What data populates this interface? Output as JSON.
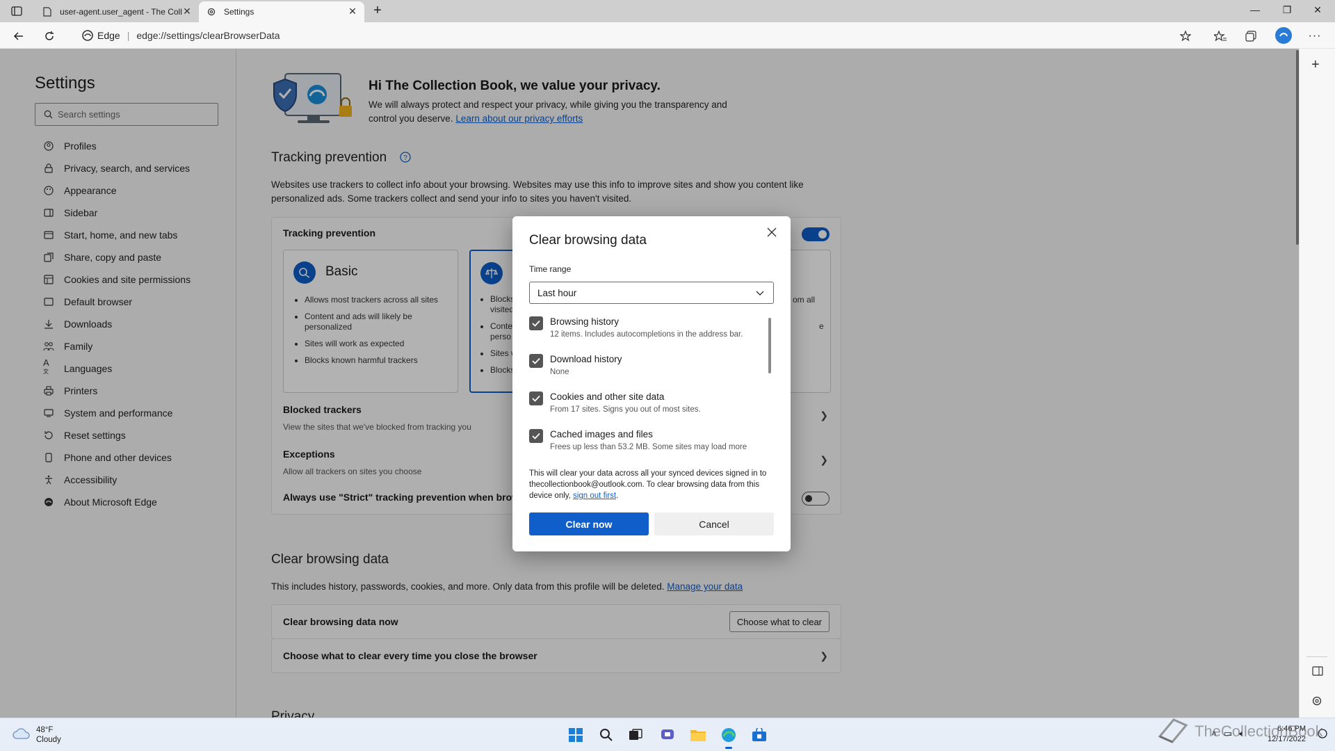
{
  "browser": {
    "tabs": [
      {
        "title": "user-agent.user_agent - The Coll",
        "active": false
      },
      {
        "title": "Settings",
        "active": true
      }
    ],
    "address": {
      "site_label": "Edge",
      "url": "edge://settings/clearBrowserData"
    }
  },
  "sidebar": {
    "title": "Settings",
    "search_placeholder": "Search settings",
    "items": [
      {
        "label": "Profiles",
        "icon": "profile-icon"
      },
      {
        "label": "Privacy, search, and services",
        "icon": "lock-icon"
      },
      {
        "label": "Appearance",
        "icon": "palette-icon"
      },
      {
        "label": "Sidebar",
        "icon": "sidebar-icon"
      },
      {
        "label": "Start, home, and new tabs",
        "icon": "home-icon"
      },
      {
        "label": "Share, copy and paste",
        "icon": "share-icon"
      },
      {
        "label": "Cookies and site permissions",
        "icon": "cookie-icon"
      },
      {
        "label": "Default browser",
        "icon": "browser-icon"
      },
      {
        "label": "Downloads",
        "icon": "download-icon"
      },
      {
        "label": "Family",
        "icon": "family-icon"
      },
      {
        "label": "Languages",
        "icon": "language-icon"
      },
      {
        "label": "Printers",
        "icon": "printer-icon"
      },
      {
        "label": "System and performance",
        "icon": "system-icon"
      },
      {
        "label": "Reset settings",
        "icon": "reset-icon"
      },
      {
        "label": "Phone and other devices",
        "icon": "phone-icon"
      },
      {
        "label": "Accessibility",
        "icon": "accessibility-icon"
      },
      {
        "label": "About Microsoft Edge",
        "icon": "edge-icon"
      }
    ]
  },
  "main": {
    "hero_title": "Hi The Collection Book, we value your privacy.",
    "hero_text": "We will always protect and respect your privacy, while giving you the transparency and control you deserve.",
    "hero_link": "Learn about our privacy efforts",
    "tracking": {
      "heading": "Tracking prevention",
      "description": "Websites use trackers to collect info about your browsing. Websites may use this info to improve sites and show you content like personalized ads. Some trackers collect and send your info to sites you haven't visited.",
      "card_label": "Tracking prevention",
      "basic": {
        "title": "Basic",
        "bullets": [
          "Allows most trackers across all sites",
          "Content and ads will likely be personalized",
          "Sites will work as expected",
          "Blocks known harmful trackers"
        ]
      },
      "balanced_bullets": [
        "Blocks",
        "visited",
        "Conte",
        "perso",
        "Sites w",
        "Blocks"
      ],
      "strict_partial": [
        "om all",
        "e"
      ],
      "blocked_title": "Blocked trackers",
      "blocked_sub": "View the sites that we've blocked from tracking you",
      "exceptions_title": "Exceptions",
      "exceptions_sub": "Allow all trackers on sites you choose",
      "strict_always": "Always use \"Strict\" tracking prevention when browsi"
    },
    "clear": {
      "heading": "Clear browsing data",
      "description": "This includes history, passwords, cookies, and more. Only data from this profile will be deleted.",
      "manage_link": "Manage your data",
      "now_label": "Clear browsing data now",
      "choose_button": "Choose what to clear",
      "every_time_label": "Choose what to clear every time you close the browser"
    },
    "privacy_heading_partial": "Privacy"
  },
  "dialog": {
    "title": "Clear browsing data",
    "time_range_label": "Time range",
    "time_range_value": "Last hour",
    "options": [
      {
        "title": "Browsing history",
        "sub": "12 items. Includes autocompletions in the address bar.",
        "checked": true
      },
      {
        "title": "Download history",
        "sub": "None",
        "checked": true
      },
      {
        "title": "Cookies and other site data",
        "sub": "From 17 sites. Signs you out of most sites.",
        "checked": true
      },
      {
        "title": "Cached images and files",
        "sub": "Frees up less than 53.2 MB. Some sites may load more",
        "checked": true
      }
    ],
    "note": "This will clear your data across all your synced devices signed in to thecollectionbook@outlook.com. To clear browsing data from this device only,",
    "note_link": "sign out first",
    "note_end": ".",
    "clear_button": "Clear now",
    "cancel_button": "Cancel"
  },
  "taskbar": {
    "weather_temp": "48°F",
    "weather_cond": "Cloudy",
    "time": "6:46 PM",
    "date": "12/17/2022",
    "watermark": "TheCollectionBook"
  },
  "colors": {
    "accent": "#0f5ec9"
  }
}
